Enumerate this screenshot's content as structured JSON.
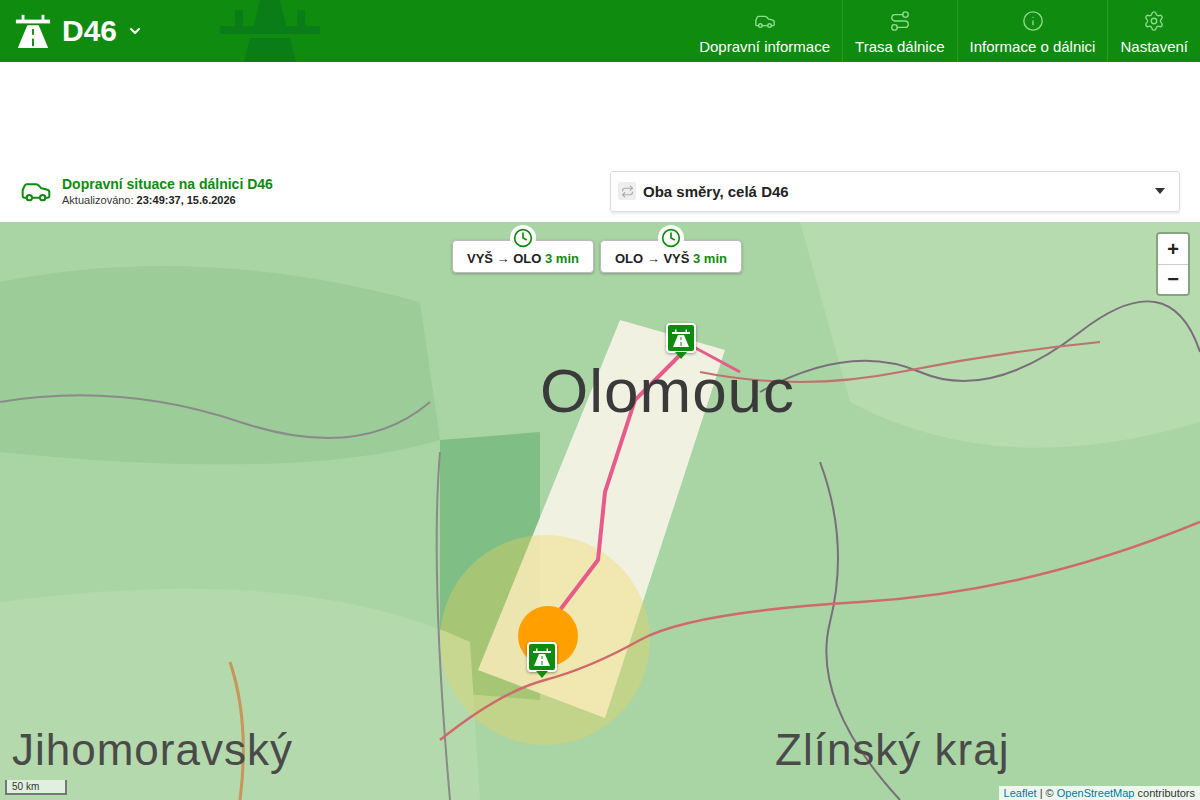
{
  "header": {
    "logo": "D46",
    "nav": [
      {
        "label": "Dopravní informace"
      },
      {
        "label": "Trasa dálnice"
      },
      {
        "label": "Informace o dálnici"
      },
      {
        "label": "Nastavení"
      }
    ]
  },
  "status": {
    "title": "Dopravní situace na dálnici D46",
    "updated_label": "Aktualizováno:",
    "updated_value": "23:49:37, 15.6.2026"
  },
  "direction_select": {
    "value": "Oba směry, celá D46"
  },
  "map": {
    "labels": [
      "Olomouc",
      "Zlínský kraj",
      "Jihomoravský"
    ],
    "travel_times": [
      {
        "route": "VYŠ → OLO",
        "time": "3 min"
      },
      {
        "route": "OLO → VYŠ",
        "time": "3 min"
      }
    ],
    "zoom": [
      "+",
      "−"
    ],
    "scale": "50 km",
    "attribution": {
      "leaflet": "Leaflet",
      "separator": "| ©",
      "osm": "OpenStreetMap",
      "suffix": "contributors"
    }
  }
}
